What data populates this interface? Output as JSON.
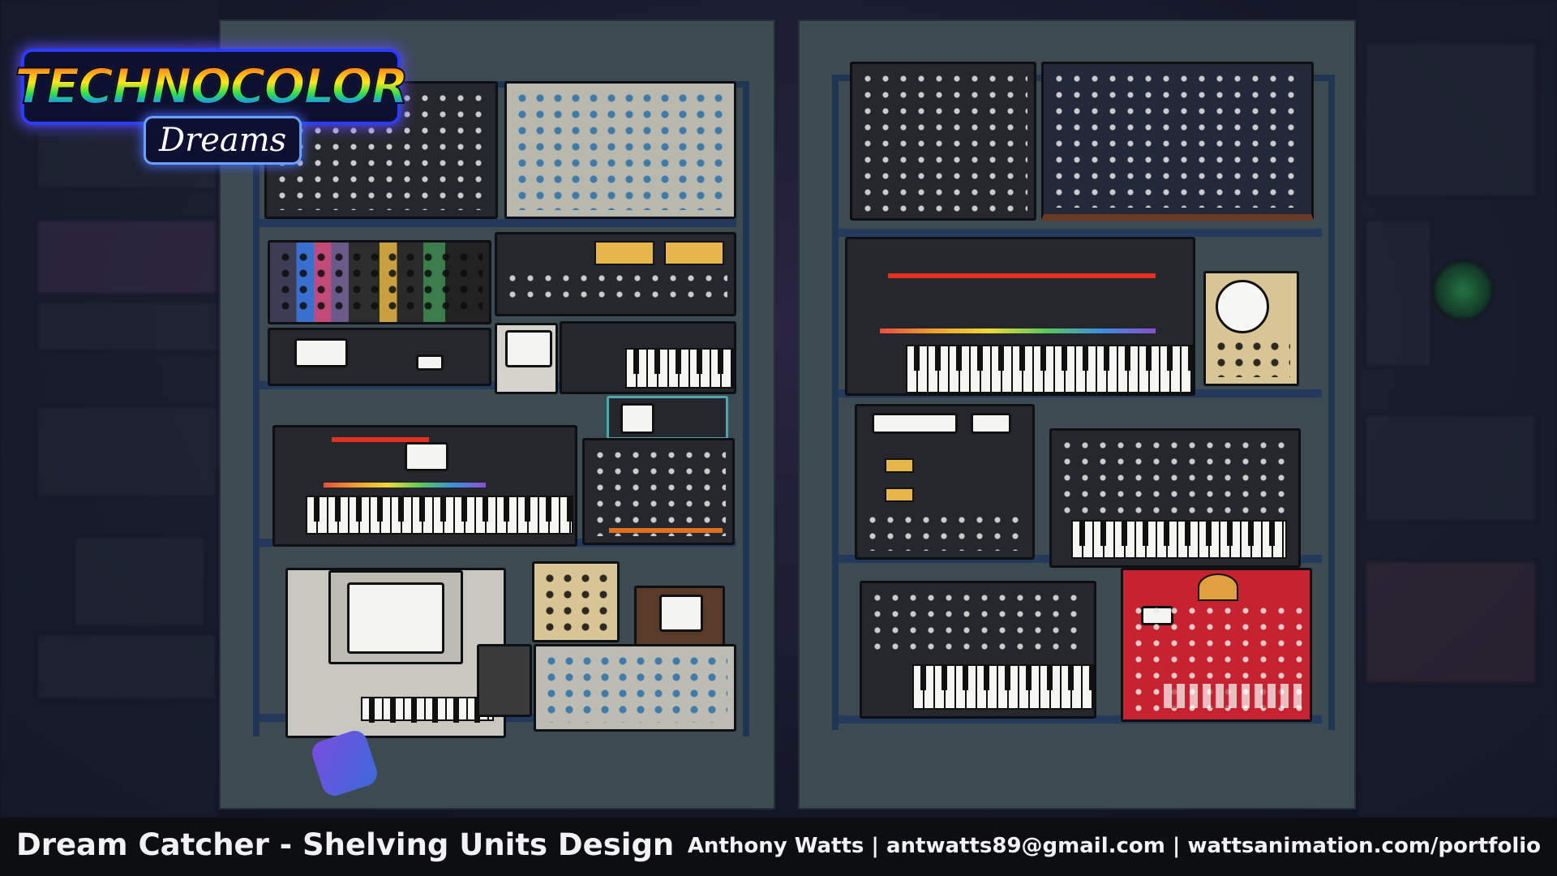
{
  "logo": {
    "main_text": "TECHNOCOLOR",
    "sub_text": "Dreams"
  },
  "footer": {
    "title": "Dream Catcher - Shelving Units Design",
    "credit": "Anthony Watts | antwatts89@gmail.com | wattsanimation.com/portfolio"
  },
  "colors": {
    "panel": "#3c4a52",
    "shelf_frame": "#1f3554",
    "footer_bg": "#0d0e12",
    "synth_red": "#c7222f",
    "logo_glow": "#5b4dff"
  }
}
